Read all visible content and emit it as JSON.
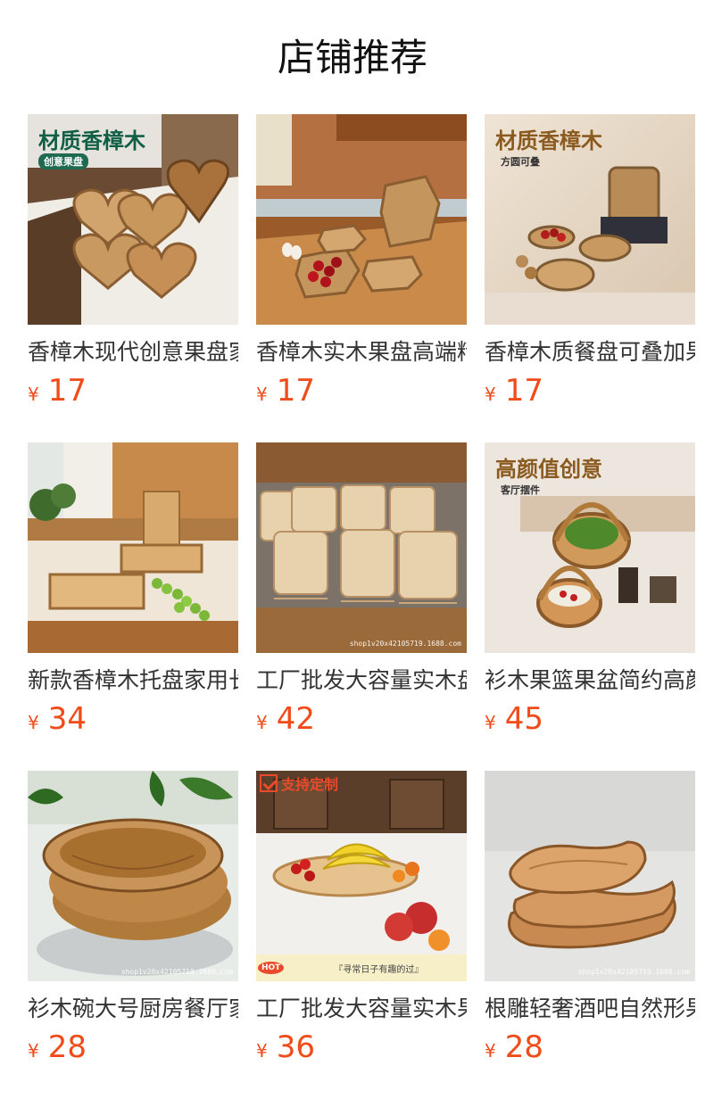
{
  "header": {
    "title": "店铺推荐"
  },
  "products": [
    {
      "name": "香樟木现代创意果盘家用",
      "currency": "¥",
      "price": "17",
      "overlay": "材质香樟木",
      "overlay_sub": "创意果盘",
      "image_icon": "heart-wood-tray-icon"
    },
    {
      "name": "香樟木实木果盘高端精品",
      "currency": "¥",
      "price": "17",
      "image_icon": "octagon-wood-tray-icon"
    },
    {
      "name": "香樟木质餐盘可叠加果盘",
      "currency": "¥",
      "price": "17",
      "overlay": "材质香樟木",
      "overlay_sub": "方圆可叠",
      "image_icon": "round-wood-tray-icon"
    },
    {
      "name": "新款香樟木托盘家用长方形",
      "currency": "¥",
      "price": "34",
      "image_icon": "rect-wood-tray-icon"
    },
    {
      "name": "工厂批发大容量实木盘子",
      "currency": "¥",
      "price": "42",
      "watermark": "shop1v20x42105719.1688.com",
      "image_icon": "stacked-trays-icon"
    },
    {
      "name": "衫木果篮果盆简约高颜值",
      "currency": "¥",
      "price": "45",
      "overlay": "高颜值创意",
      "overlay_sub": "客厅摆件",
      "image_icon": "wood-basket-icon"
    },
    {
      "name": "衫木碗大号厨房餐厅家用",
      "currency": "¥",
      "price": "28",
      "watermark": "shop1v20x42105719.1688.com",
      "image_icon": "wood-bowl-icon"
    },
    {
      "name": "工厂批发大容量实木果盘",
      "currency": "¥",
      "price": "36",
      "badge": "支持定制",
      "hot": "HOT",
      "slogan": "『寻常日子有趣的过』",
      "image_icon": "fruit-platter-icon"
    },
    {
      "name": "根雕轻奢酒吧自然形果盘",
      "currency": "¥",
      "price": "28",
      "watermark": "shop1v20x42105719.1688.com",
      "image_icon": "root-carving-tray-icon"
    }
  ]
}
